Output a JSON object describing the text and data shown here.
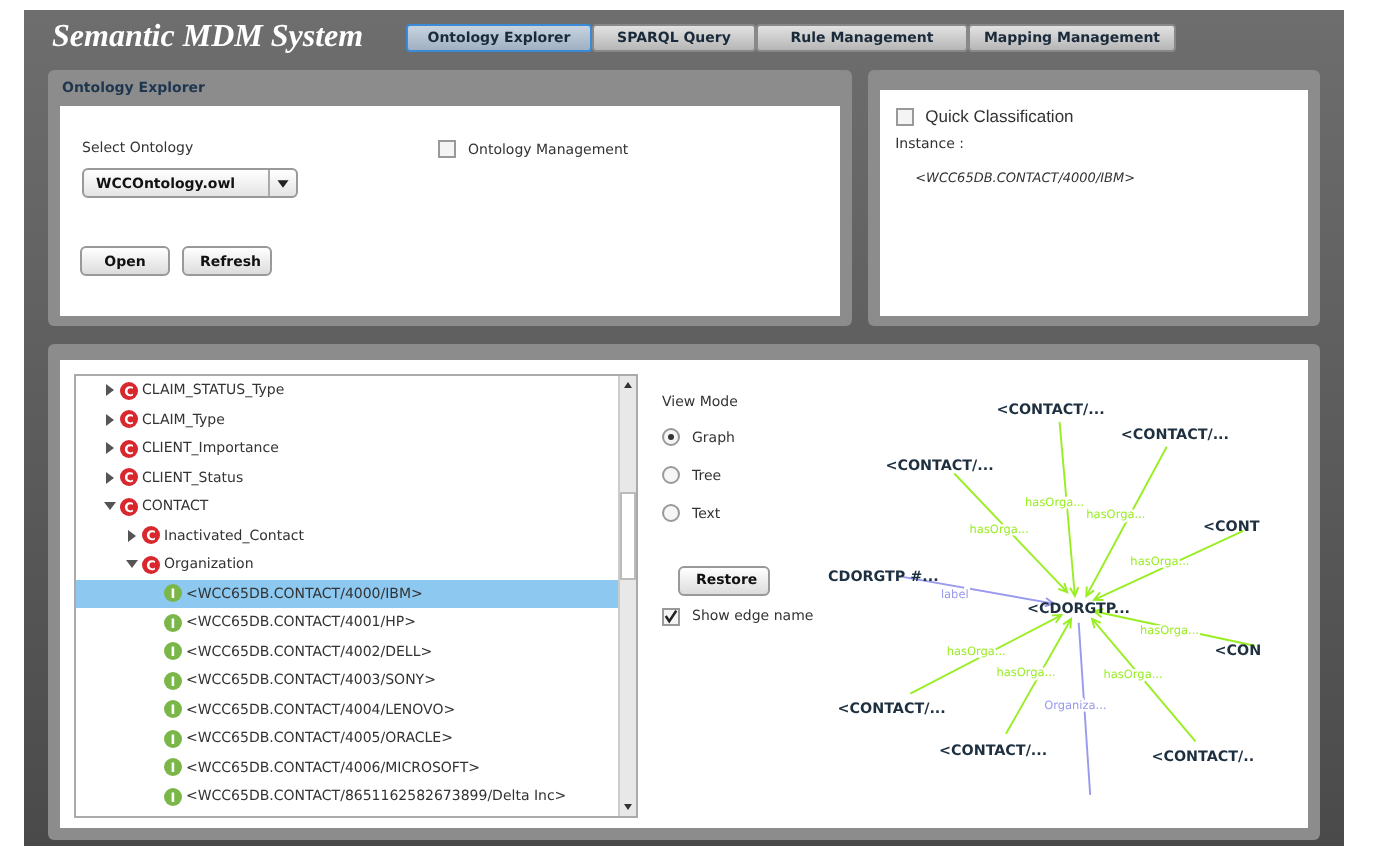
{
  "app_title": "Semantic MDM System",
  "tabs": [
    {
      "label": "Ontology Explorer",
      "selected": true
    },
    {
      "label": "SPARQL Query",
      "selected": false
    },
    {
      "label": "Rule Management",
      "selected": false
    },
    {
      "label": "Mapping Management",
      "selected": false
    }
  ],
  "ontology_panel": {
    "title": "Ontology Explorer",
    "select_label": "Select Ontology",
    "select_value": "WCCOntology.owl",
    "management": {
      "label": "Ontology Management",
      "checked": false
    },
    "buttons": [
      "Open",
      "Refresh"
    ]
  },
  "classification_panel": {
    "quick": {
      "label": "Quick Classification",
      "checked": false
    },
    "instance_label": "Instance :",
    "instance_value": "<WCC65DB.CONTACT/4000/IBM>"
  },
  "tree": [
    {
      "label": "CLAIM_STATUS_Type",
      "badge": "C",
      "kind": "class",
      "expanded": false,
      "selected": false
    },
    {
      "label": "CLAIM_Type",
      "badge": "C",
      "kind": "class",
      "expanded": false,
      "selected": false
    },
    {
      "label": "CLIENT_Importance",
      "badge": "C",
      "kind": "class",
      "expanded": false,
      "selected": false
    },
    {
      "label": "CLIENT_Status",
      "badge": "C",
      "kind": "class",
      "expanded": false,
      "selected": false
    },
    {
      "label": "CONTACT",
      "badge": "C",
      "kind": "class",
      "expanded": true,
      "selected": false,
      "children": [
        {
          "label": "Inactivated_Contact",
          "badge": "C",
          "kind": "class",
          "expanded": false,
          "selected": false
        },
        {
          "label": "Organization",
          "badge": "C",
          "kind": "class",
          "expanded": true,
          "selected": false,
          "children": [
            {
              "label": "<WCC65DB.CONTACT/4000/IBM>",
              "badge": "I",
              "kind": "instance",
              "selected": true
            },
            {
              "label": "<WCC65DB.CONTACT/4001/HP>",
              "badge": "I",
              "kind": "instance",
              "selected": false
            },
            {
              "label": "<WCC65DB.CONTACT/4002/DELL>",
              "badge": "I",
              "kind": "instance",
              "selected": false
            },
            {
              "label": "<WCC65DB.CONTACT/4003/SONY>",
              "badge": "I",
              "kind": "instance",
              "selected": false
            },
            {
              "label": "<WCC65DB.CONTACT/4004/LENOVO>",
              "badge": "I",
              "kind": "instance",
              "selected": false
            },
            {
              "label": "<WCC65DB.CONTACT/4005/ORACLE>",
              "badge": "I",
              "kind": "instance",
              "selected": false
            },
            {
              "label": "<WCC65DB.CONTACT/4006/MICROSOFT>",
              "badge": "I",
              "kind": "instance",
              "selected": false
            },
            {
              "label": "<WCC65DB.CONTACT/8651162582673899/Delta Inc>",
              "badge": "I",
              "kind": "instance",
              "selected": false
            }
          ]
        }
      ]
    }
  ],
  "view_mode": {
    "label": "View Mode",
    "options": [
      {
        "label": "Graph",
        "selected": true
      },
      {
        "label": "Tree",
        "selected": false
      },
      {
        "label": "Text",
        "selected": false
      }
    ]
  },
  "restore_button": "Restore",
  "show_edge_name": {
    "label": "Show edge name",
    "checked": true
  },
  "graph": {
    "center": "<CDORGTP...",
    "nodes": [
      {
        "label": "<CONTACT/..."
      },
      {
        "label": "<CONTACT/..."
      },
      {
        "label": "<CONTACT/..."
      },
      {
        "label": "<CONT"
      },
      {
        "label": "CDORGTP #..."
      },
      {
        "label": "<CON"
      },
      {
        "label": "<CONTACT/..."
      },
      {
        "label": "<CONTACT/..."
      },
      {
        "label": "<CONTACT/.."
      }
    ],
    "edges": [
      {
        "label": "hasOrga...",
        "color": "#99ee22"
      },
      {
        "label": "hasOrga...",
        "color": "#99ee22"
      },
      {
        "label": "hasOrga...",
        "color": "#99ee22"
      },
      {
        "label": "hasOrga...",
        "color": "#99ee22"
      },
      {
        "label": "label",
        "color": "#9999ee"
      },
      {
        "label": "hasOrga...",
        "color": "#99ee22"
      },
      {
        "label": "hasOrga...",
        "color": "#99ee22"
      },
      {
        "label": "hasOrga...",
        "color": "#99ee22"
      },
      {
        "label": "hasOrga...",
        "color": "#99ee22"
      },
      {
        "label": "Organiza...",
        "color": "#9999ee"
      }
    ]
  }
}
